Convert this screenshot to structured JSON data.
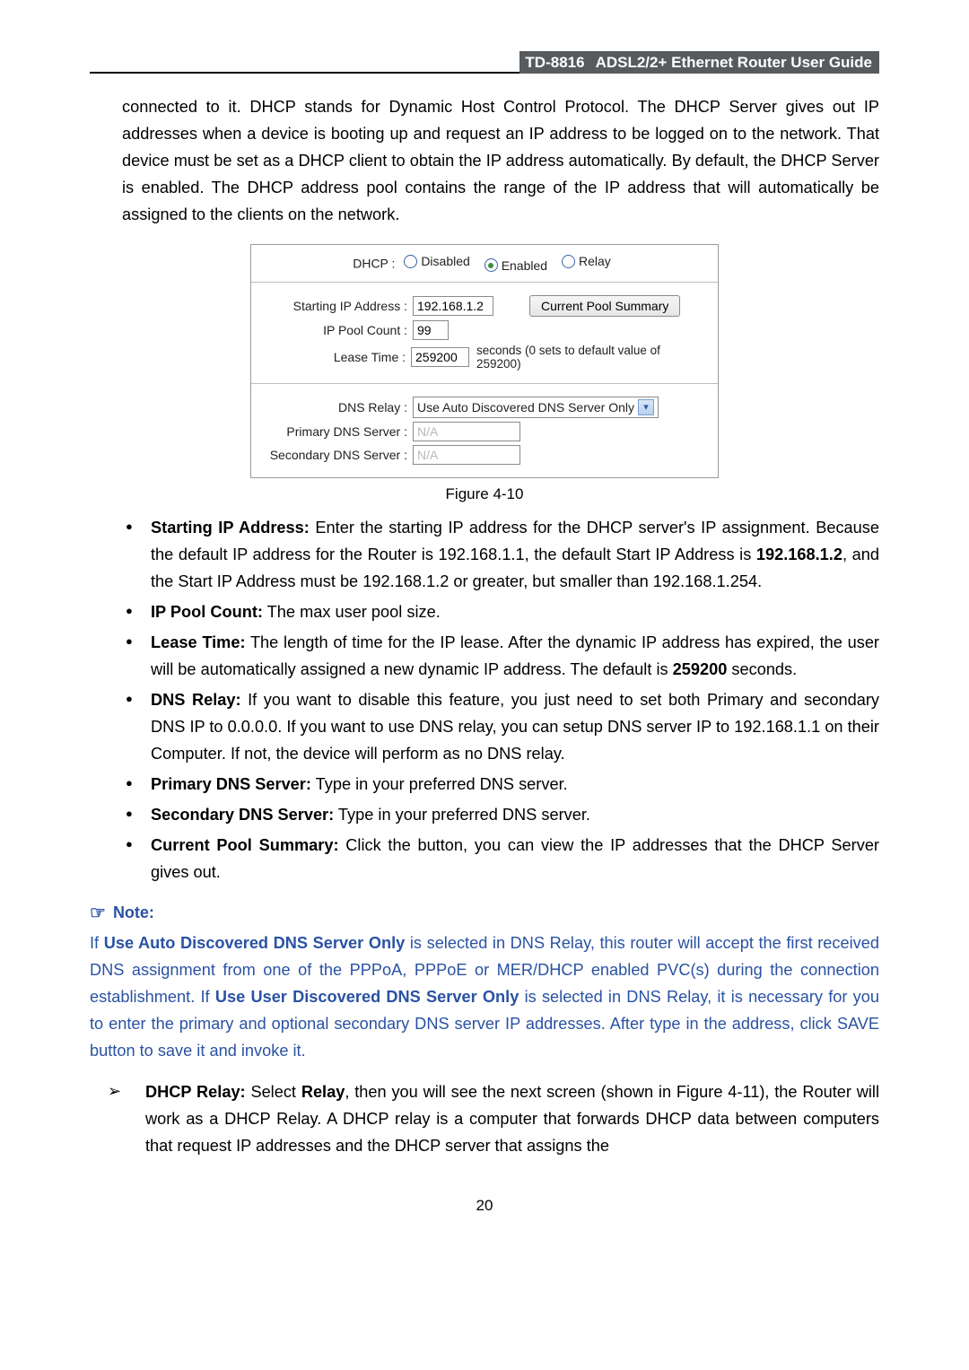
{
  "header": {
    "model": "TD-8816",
    "title": "ADSL2/2+  Ethernet  Router  User  Guide"
  },
  "intro_text": "connected to it. DHCP stands for Dynamic Host Control Protocol. The DHCP Server gives out IP addresses when a device is booting up and request an IP address to be logged on to the network. That device must be set as a DHCP client to obtain the IP address automatically. By default, the DHCP Server is enabled. The DHCP address pool contains the range of the IP address that will automatically be assigned to the clients on the network.",
  "figure": {
    "dhcp_label": "DHCP :",
    "radio_disabled": "Disabled",
    "radio_enabled": "Enabled",
    "radio_relay": "Relay",
    "starting_ip_label": "Starting IP Address :",
    "starting_ip_value": "192.168.1.2",
    "pool_btn": "Current Pool Summary",
    "ip_pool_label": "IP Pool Count :",
    "ip_pool_value": "99",
    "lease_label": "Lease Time :",
    "lease_value": "259200",
    "lease_suffix": "seconds   (0 sets to default value of 259200)",
    "dns_relay_label": "DNS Relay :",
    "dns_relay_value": "Use Auto Discovered DNS Server Only",
    "primary_dns_label": "Primary DNS Server  :",
    "primary_dns_value": "N/A",
    "secondary_dns_label": "Secondary DNS Server :",
    "secondary_dns_value": "N/A"
  },
  "figure_caption": "Figure 4-10",
  "bullets": {
    "b1_label": "Starting IP Address:",
    "b1_text_a": " Enter the starting IP address for the DHCP server's IP assignment. Because the default IP address for the Router is 192.168.1.1, the default Start IP Address is ",
    "b1_bold": "192.168.1.2",
    "b1_text_b": ", and the Start IP Address must be 192.168.1.2 or greater, but smaller than 192.168.1.254.",
    "b2_label": "IP Pool Count:",
    "b2_text": " The max user pool size.",
    "b3_label": "Lease Time:",
    "b3_text_a": " The length of time for the IP lease. After the dynamic IP address has expired, the user will be automatically assigned a new dynamic IP address. The default is ",
    "b3_bold": "259200",
    "b3_text_b": " seconds.",
    "b4_label": "DNS Relay:",
    "b4_text": " If you want to disable this feature, you just need to set both Primary and secondary DNS IP to 0.0.0.0. If you want to use DNS relay, you can setup DNS server IP to 192.168.1.1 on their Computer. If not, the device will perform as no DNS relay.",
    "b5_label": "Primary DNS Server:",
    "b5_text": " Type in your preferred DNS server.",
    "b6_label": "Secondary DNS Server:",
    "b6_text": " Type in your preferred DNS server.",
    "b7_label": "Current Pool Summary:",
    "b7_text": " Click the button, you can view the IP addresses that the DHCP Server gives out."
  },
  "note": {
    "note_head": "Note:",
    "note_a": "If ",
    "note_bold1": "Use Auto Discovered DNS Server Only",
    "note_b": " is selected in DNS Relay, this router will accept the first received DNS assignment from one of the PPPoA, PPPoE or MER/DHCP enabled PVC(s) during the connection establishment. If ",
    "note_bold2": "Use User Discovered DNS Server Only",
    "note_c": " is selected in DNS Relay, it is necessary for you to enter the primary and optional secondary DNS server IP addresses. After type in the address, click SAVE button to save it and invoke it."
  },
  "arrow": {
    "a_label": "DHCP Relay:",
    "a_text_a": " Select ",
    "a_bold1": "Relay",
    "a_text_b": ", then you will see the next screen (shown in Figure 4-11), the Router will work as a DHCP Relay. A DHCP relay is a computer that forwards DHCP data between computers that request IP addresses and the DHCP server that assigns the"
  },
  "page_number": "20"
}
